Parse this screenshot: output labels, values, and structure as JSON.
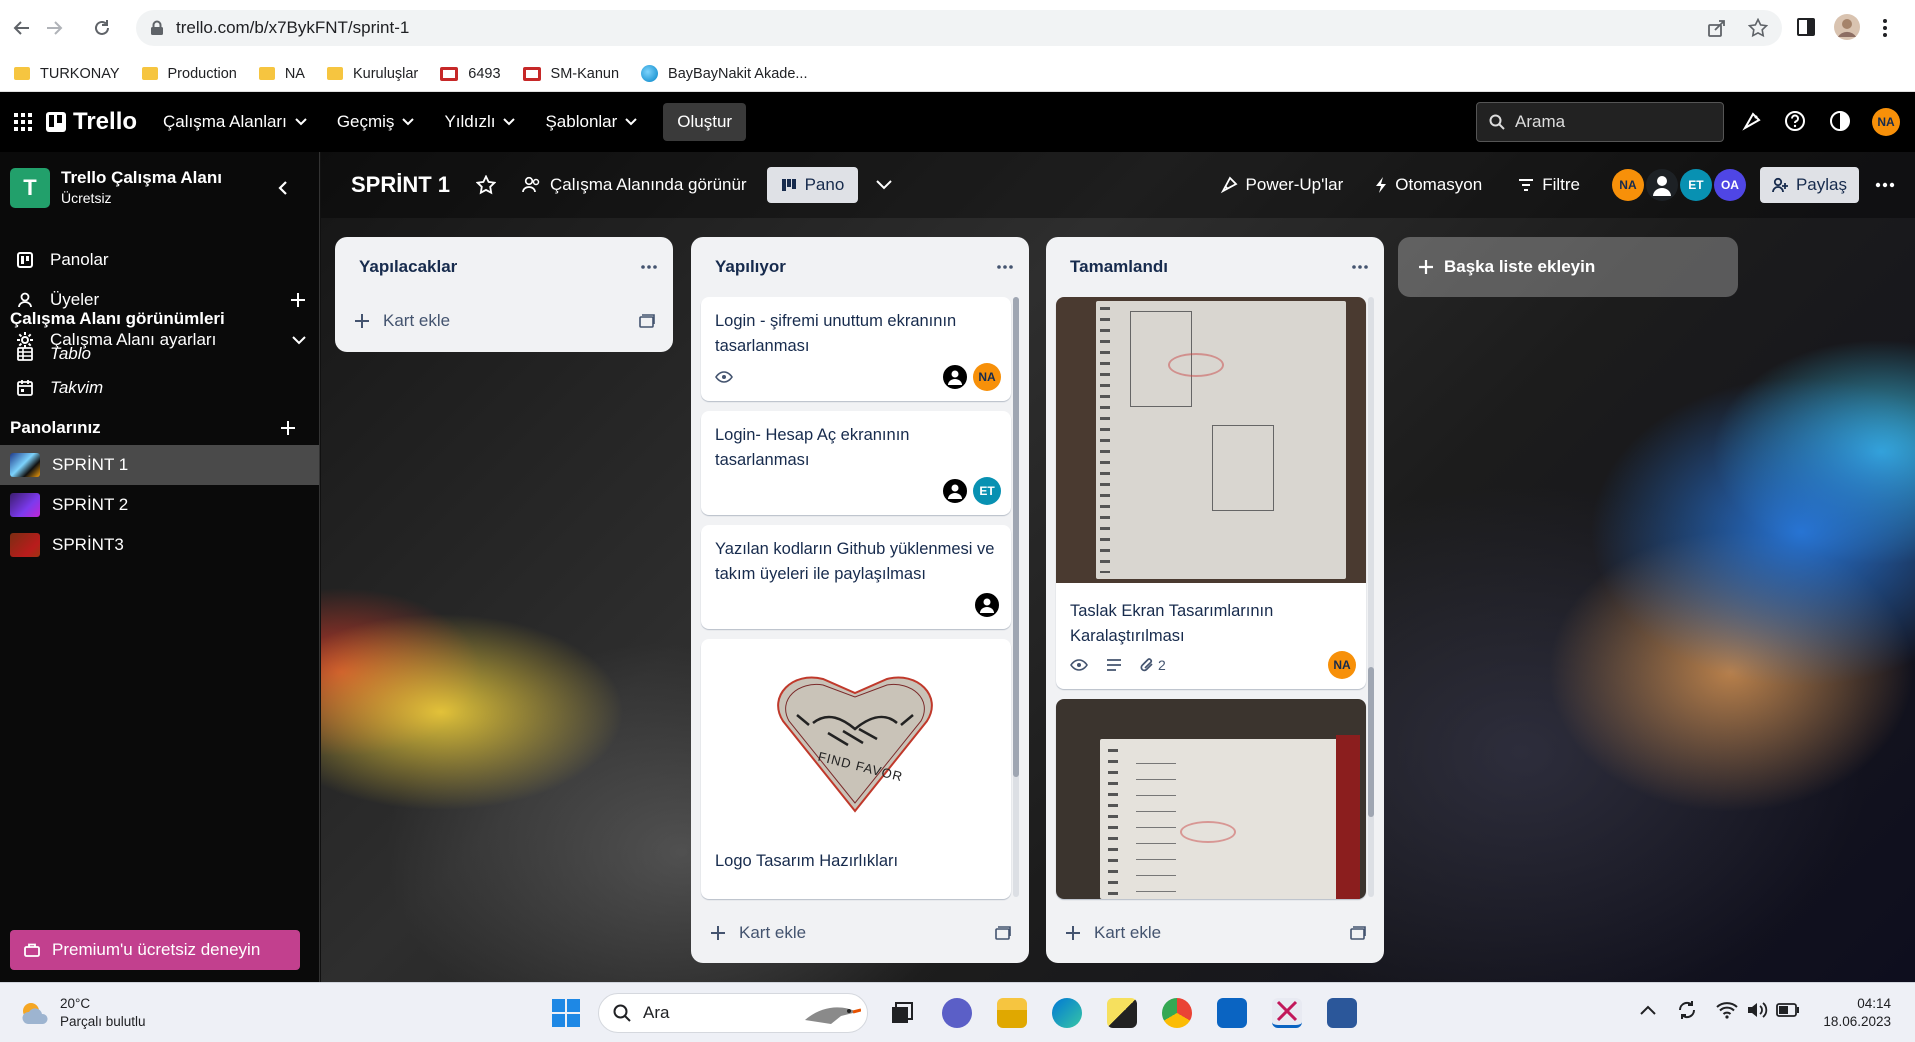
{
  "browser": {
    "url": "trello.com/b/x7BykFNT/sprint-1",
    "bookmarks": [
      {
        "label": "TURKONAY",
        "icon": "folder-icon"
      },
      {
        "label": "Production",
        "icon": "folder-icon"
      },
      {
        "label": "NA",
        "icon": "folder-icon"
      },
      {
        "label": "Kuruluşlar",
        "icon": "folder-icon"
      },
      {
        "label": "6493",
        "icon": "bookmark-icon"
      },
      {
        "label": "SM-Kanun",
        "icon": "bookmark-icon"
      },
      {
        "label": "BayBayNakit Akade...",
        "icon": "globe-icon"
      }
    ]
  },
  "header": {
    "logo": "Trello",
    "menus": [
      "Çalışma Alanları",
      "Geçmiş",
      "Yıldızlı",
      "Şablonlar"
    ],
    "create_label": "Oluştur",
    "search_placeholder": "Arama",
    "user_initials": "NA"
  },
  "sidebar": {
    "workspace_badge": "T",
    "workspace_name": "Trello Çalışma Alanı",
    "workspace_plan": "Ücretsiz",
    "items": [
      {
        "label": "Panolar",
        "icon": "board-icon"
      },
      {
        "label": "Üyeler",
        "icon": "user-icon"
      },
      {
        "label": "Çalışma Alanı ayarları",
        "icon": "gear-icon"
      }
    ],
    "views_heading": "Çalışma Alanı görünümleri",
    "views": [
      {
        "label": "Tablo",
        "icon": "table-icon"
      },
      {
        "label": "Takvim",
        "icon": "calendar-icon"
      }
    ],
    "boards_heading": "Panolarınız",
    "boards": [
      {
        "label": "SPRİNT 1",
        "active": true
      },
      {
        "label": "SPRİNT 2",
        "active": false
      },
      {
        "label": "SPRİNT3",
        "active": false
      }
    ],
    "premium_label": "Premium'u ücretsiz deneyin"
  },
  "board": {
    "title": "SPRİNT 1",
    "visibility": "Çalışma Alanında görünür",
    "view": "Pano",
    "power_ups": "Power-Up'lar",
    "automation": "Otomasyon",
    "filter": "Filtre",
    "members": [
      "NA",
      "",
      "ET",
      "OA"
    ],
    "share": "Paylaş",
    "add_list": "Başka liste ekleyin",
    "add_card": "Kart ekle",
    "lists": [
      {
        "title": "Yapılacaklar"
      },
      {
        "title": "Yapılıyor",
        "cards": [
          {
            "text": "Login - şifremi unuttum ekranının tasarlanması",
            "members": [
              "",
              "NA"
            ]
          },
          {
            "text": "Login- Hesap Aç ekranının tasarlanması",
            "members": [
              "",
              "ET"
            ]
          },
          {
            "text": "Yazılan kodların Github yüklenmesi ve takım üyeleri ile paylaşılması",
            "members": [
              ""
            ]
          },
          {
            "text": "Logo Tasarım Hazırlıkları",
            "logo_text": "FIND FAVOR"
          }
        ]
      },
      {
        "title": "Tamamlandı",
        "cards": [
          {
            "text": "Taslak Ekran Tasarımlarının Karalaştırılması",
            "attachments": "2",
            "members": [
              "NA"
            ]
          },
          {
            "text": ""
          }
        ]
      }
    ]
  },
  "taskbar": {
    "temperature": "20°C",
    "weather": "Parçalı bulutlu",
    "search": "Ara",
    "time": "04:14",
    "date": "18.06.2023"
  }
}
